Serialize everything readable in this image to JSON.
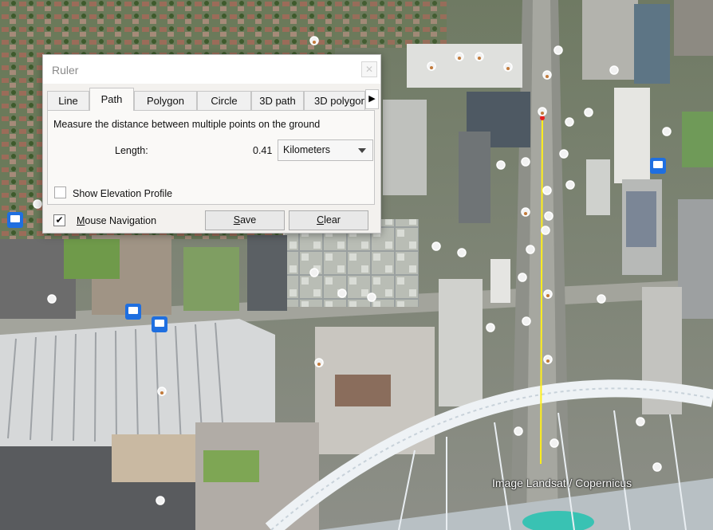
{
  "map": {
    "attribution": "Image Landsat / Copernicus",
    "colors": {
      "path_line": "#ffef1a",
      "start_point": "#e82020",
      "transit_badge": "#1f6fe0"
    },
    "icons": [
      "photo-pin-icon",
      "bus-stop-icon"
    ]
  },
  "ruler": {
    "title": "Ruler",
    "close_icon": "close-icon",
    "tabs": [
      {
        "label": "Line",
        "active": false
      },
      {
        "label": "Path",
        "active": true
      },
      {
        "label": "Polygon",
        "active": false
      },
      {
        "label": "Circle",
        "active": false
      },
      {
        "label": "3D path",
        "active": false
      },
      {
        "label": "3D polygon",
        "active": false
      }
    ],
    "scroll_icon": "triangle-right-icon",
    "description": "Measure the distance between multiple points on the ground",
    "length_label": "Length:",
    "length_value": "0.41",
    "unit": "Kilometers",
    "elevation_profile": {
      "label": "Show Elevation Profile",
      "checked": false
    },
    "mouse_navigation": {
      "label_first": "M",
      "label_rest": "ouse Navigation",
      "checked": true
    },
    "save": {
      "first": "S",
      "rest": "ave"
    },
    "clear": {
      "first": "C",
      "rest": "lear"
    }
  }
}
